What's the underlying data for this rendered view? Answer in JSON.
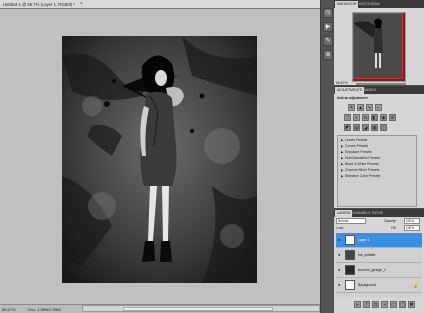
{
  "document": {
    "tab_title": "Untitled-1 @ 66.7% (Layer 1, RGB/8) *",
    "close_glyph": "×",
    "zoom": "66.67%",
    "doc_size": "Doc: 1.89M/7.05M"
  },
  "panels": {
    "navigator": {
      "tabs": [
        "NAVIGATOR",
        "HISTOGRAM"
      ],
      "zoom": "66.67%"
    },
    "adjustments": {
      "tabs": [
        "ADJUSTMENTS",
        "MASKS"
      ],
      "heading": "Add an adjustment",
      "presets": [
        "Levels Presets",
        "Curves Presets",
        "Exposure Presets",
        "Hue/Saturation Presets",
        "Black & White Presets",
        "Channel Mixer Presets",
        "Selective Color Presets"
      ]
    },
    "layers": {
      "tabs": [
        "LAYERS",
        "CHANNELS",
        "PATHS"
      ],
      "blend_mode": "Normal",
      "opacity_label": "Opacity:",
      "opacity": "100%",
      "lock_label": "Lock:",
      "fill_label": "Fill:",
      "fill": "100%",
      "items": [
        {
          "name": "Layer 1",
          "selected": true
        },
        {
          "name": "Ink_splatter",
          "selected": false
        },
        {
          "name": "Autumn_grunge_1",
          "selected": false
        },
        {
          "name": "Background",
          "selected": false
        }
      ]
    }
  },
  "colors": {
    "selection": "#3b8fe3",
    "navigator_frame": "#e22222",
    "panel_bg": "#d6d6d6",
    "canvas_bg": "#c0c0c0"
  }
}
